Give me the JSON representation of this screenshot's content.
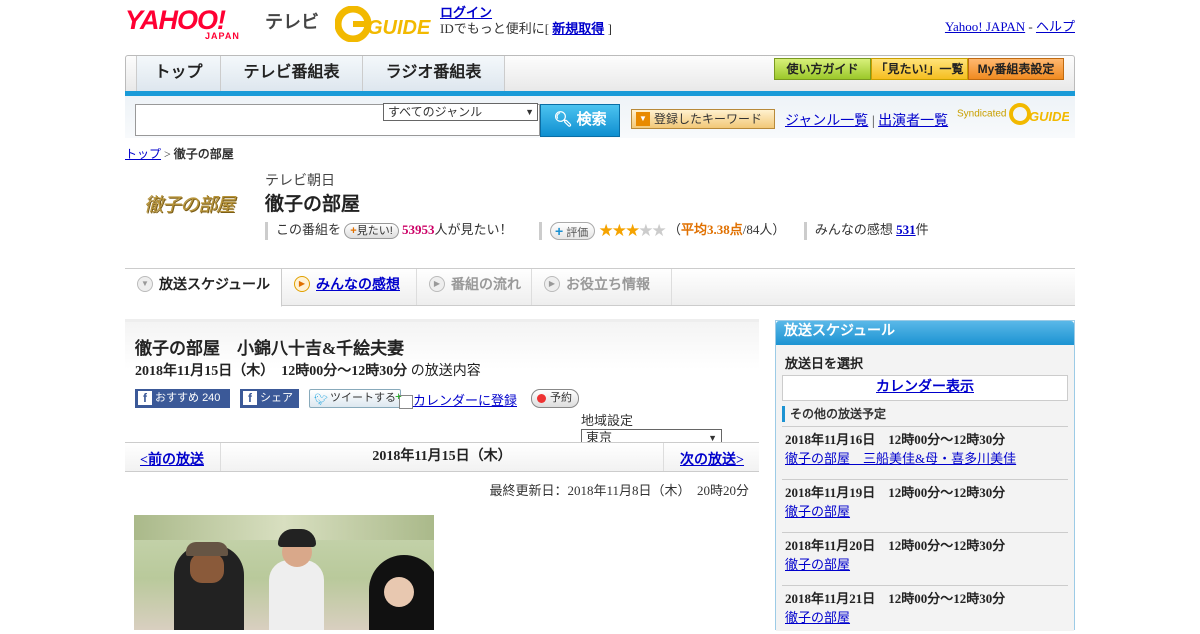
{
  "header": {
    "logo_text": "YAHOO!",
    "logo_sub": "JAPAN",
    "tv_label": "テレビ",
    "gguide_label": "GUIDE",
    "login": "ログイン",
    "login_sub_prefix": "IDでもっと便利に[",
    "signup": "新規取得",
    "login_sub_suffix": "]",
    "yahoo_japan": "Yahoo! JAPAN",
    "sep": "-",
    "help": "ヘルプ"
  },
  "nav": {
    "tabs": [
      "トップ",
      "テレビ番組表",
      "ラジオ番組表"
    ],
    "buttons": [
      "使い方ガイド",
      "「見たい!」一覧",
      "My番組表設定"
    ]
  },
  "search": {
    "genre": "すべてのジャンル",
    "button": "検索",
    "keyword_btn": "登録したキーワード",
    "genre_list": "ジャンル一覧",
    "divider": "|",
    "cast_list": "出演者一覧",
    "syndicated": "Syndicated"
  },
  "breadcrumb": {
    "top": "トップ",
    "sep": ">",
    "current": "徹子の部屋"
  },
  "program": {
    "thumb_text": "徹子の部屋",
    "channel": "テレビ朝日",
    "title": "徹子の部屋",
    "want_prefix": "この番組を",
    "want_btn": "見たい!",
    "want_count": "53953",
    "want_suffix": "人が見たい！",
    "rating_btn": "評価",
    "stars_on": "★★★",
    "stars_off": "★★",
    "avg_open": "（",
    "avg_label": "平均3.38点",
    "avg_count": "/84人）",
    "impressions_label": "みんなの感想",
    "impressions_count": "531",
    "impressions_unit": "件"
  },
  "tabs": {
    "schedule": "放送スケジュール",
    "impressions": "みんなの感想",
    "flow": "番組の流れ",
    "info": "お役立ち情報"
  },
  "episode": {
    "title": "徹子の部屋　小錦八十吉&千絵夫妻",
    "date": "2018年11月15日（木）　12時00分～12時30分",
    "date_suffix": "の放送内容",
    "fb_recommend": "おすすめ",
    "fb_count": "240",
    "fb_share": "シェア",
    "tweet": "ツイートする",
    "calendar": "カレンダーに登録",
    "reserve": "予約",
    "region_label": "地域設定",
    "region": "東京",
    "prev": "<前の放送",
    "current_date": "2018年11月15日（木）",
    "next": "次の放送>",
    "updated": "最終更新日：2018年11月8日（木）　20時20分"
  },
  "sidebar": {
    "title": "放送スケジュール",
    "select_date": "放送日を選択",
    "calendar": "カレンダー表示",
    "other": "その他の放送予定",
    "items": [
      {
        "date": "2018年11月16日　12時00分～12時30分",
        "title": "徹子の部屋　三船美佳&母・喜多川美佳"
      },
      {
        "date": "2018年11月19日　12時00分～12時30分",
        "title": "徹子の部屋"
      },
      {
        "date": "2018年11月20日　12時00分～12時30分",
        "title": "徹子の部屋"
      },
      {
        "date": "2018年11月21日　12時00分～12時30分",
        "title": "徹子の部屋"
      }
    ]
  },
  "colors": {
    "accent": "#1a9bd8",
    "brand_red": "#ff0033",
    "want_count": "#cc0066",
    "rating": "#e07000"
  }
}
